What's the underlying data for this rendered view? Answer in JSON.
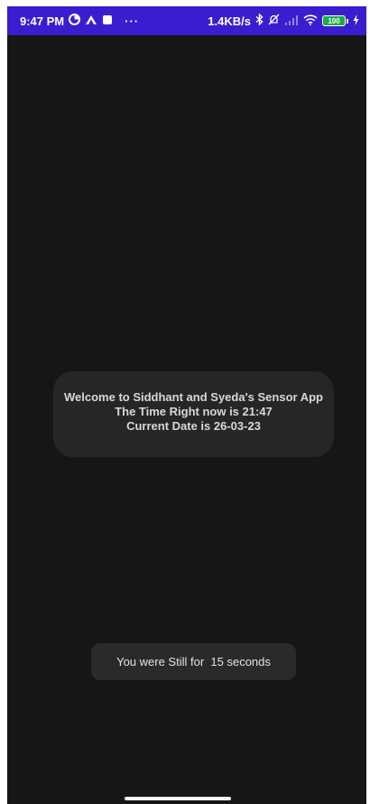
{
  "status_bar": {
    "time": "9:47 PM",
    "left_icons": [
      "data-saver-icon",
      "notification-app-icon",
      "square-app-icon"
    ],
    "more": "···",
    "network_speed": "1.4KB/s",
    "right_icons": [
      "bluetooth-icon",
      "mute-icon",
      "signal-icon",
      "wifi-icon"
    ],
    "battery": "100",
    "charging_icon": "charging-bolt-icon",
    "background_color": "#3b1dd0"
  },
  "welcome_card": {
    "line1": "Welcome to Siddhant and Syeda's Sensor App",
    "line2": "The Time Right now is 21:47",
    "line3": "Current Date is 26-03-23"
  },
  "toast": {
    "message": "You were Still for  15 seconds"
  }
}
